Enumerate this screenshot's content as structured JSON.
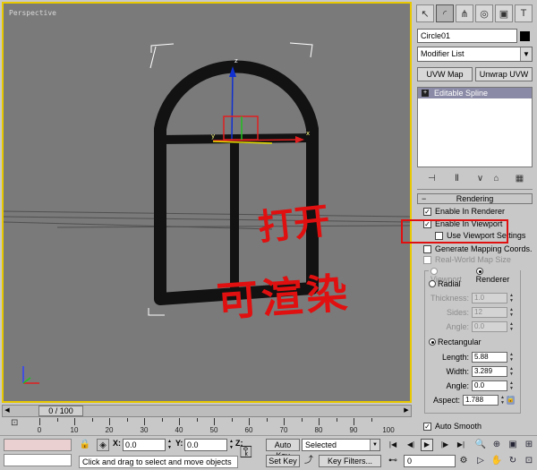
{
  "viewport": {
    "label": "Perspective"
  },
  "annotations": {
    "top_text": "打开",
    "bottom_text": "可渲染"
  },
  "panel": {
    "tabs": [
      {
        "icon": "create-icon",
        "glyph": "↖"
      },
      {
        "icon": "modify-icon",
        "glyph": "◜"
      },
      {
        "icon": "hierarchy-icon",
        "glyph": "⋔"
      },
      {
        "icon": "motion-icon",
        "glyph": "◎"
      },
      {
        "icon": "display-icon",
        "glyph": "▣"
      },
      {
        "icon": "utilities-icon",
        "glyph": "T"
      }
    ],
    "object_name": "Circle01",
    "object_color": "#000000",
    "modifier_list": "Modifier List",
    "uvw_map": "UVW Map",
    "unwrap_uvw": "Unwrap UVW",
    "stack_item": "Editable Spline",
    "rendering": {
      "title": "Rendering",
      "enable_in_renderer": "Enable In Renderer",
      "enable_in_viewport": "Enable In Viewport",
      "use_viewport_settings": "Use Viewport Settings",
      "generate_mapping": "Generate Mapping Coords.",
      "real_world": "Real-World Map Size",
      "viewport": "Viewport",
      "renderer": "Renderer",
      "radial": "Radial",
      "thickness_label": "Thickness:",
      "thickness_value": "1.0",
      "sides_label": "Sides:",
      "sides_value": "12",
      "angle_label": "Angle:",
      "angle_value": "0.0",
      "rectangular": "Rectangular",
      "length_label": "Length:",
      "length_value": "5.88",
      "width_label": "Width:",
      "width_value": "3.289",
      "angle2_label": "Angle:",
      "angle2_value": "0.0",
      "aspect_label": "Aspect:",
      "aspect_value": "1.788",
      "auto_smooth": "Auto Smooth"
    }
  },
  "timeline": {
    "frame_display": "0 / 100",
    "ticks": [
      "0",
      "10",
      "20",
      "30",
      "40",
      "50",
      "60",
      "70",
      "80",
      "90",
      "100"
    ]
  },
  "status": {
    "x_label": "X:",
    "x_value": "0.0",
    "y_label": "Y:",
    "y_value": "0.0",
    "z_label": "Z:",
    "prompt": "Click and drag to select and move objects",
    "auto_key": "Auto Key",
    "set_key": "Set Key",
    "selected": "Selected",
    "key_filters": "Key Filters...",
    "frame_value": "0"
  }
}
